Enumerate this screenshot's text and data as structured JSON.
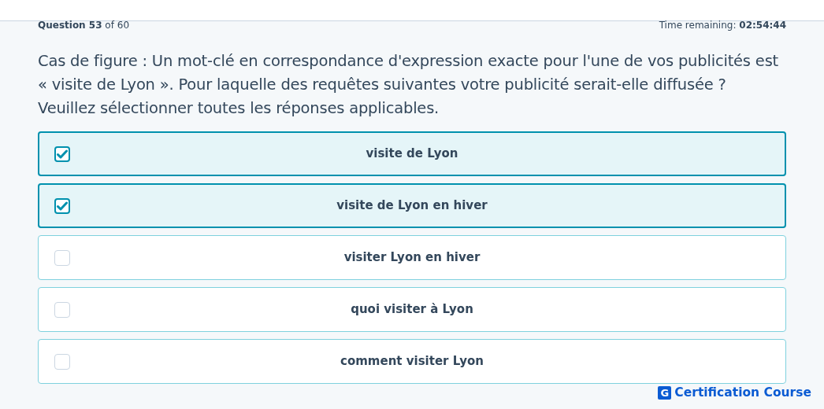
{
  "progress": "**Question 53** of 60",
  "timer": "Time remaining: **02:54:44**",
  "question": "Cas de figure : Un mot-clé en correspondance d'expression exacte pour l'une de vos publicités est « visite de Lyon ». Pour laquelle des requêtes suivantes votre publicité serait-elle diffusée ? Veuillez sélectionner toutes les réponses applicables.",
  "options": [
    {
      "label": "visite de Lyon",
      "checked": true
    },
    {
      "label": "visite de Lyon en hiver",
      "checked": true
    },
    {
      "label": "visiter Lyon en hiver",
      "checked": false
    },
    {
      "label": "quoi visiter à Lyon",
      "checked": false
    },
    {
      "label": "comment visiter Lyon",
      "checked": false
    }
  ],
  "logo": {
    "mark": "G",
    "text": "Certification Course"
  }
}
